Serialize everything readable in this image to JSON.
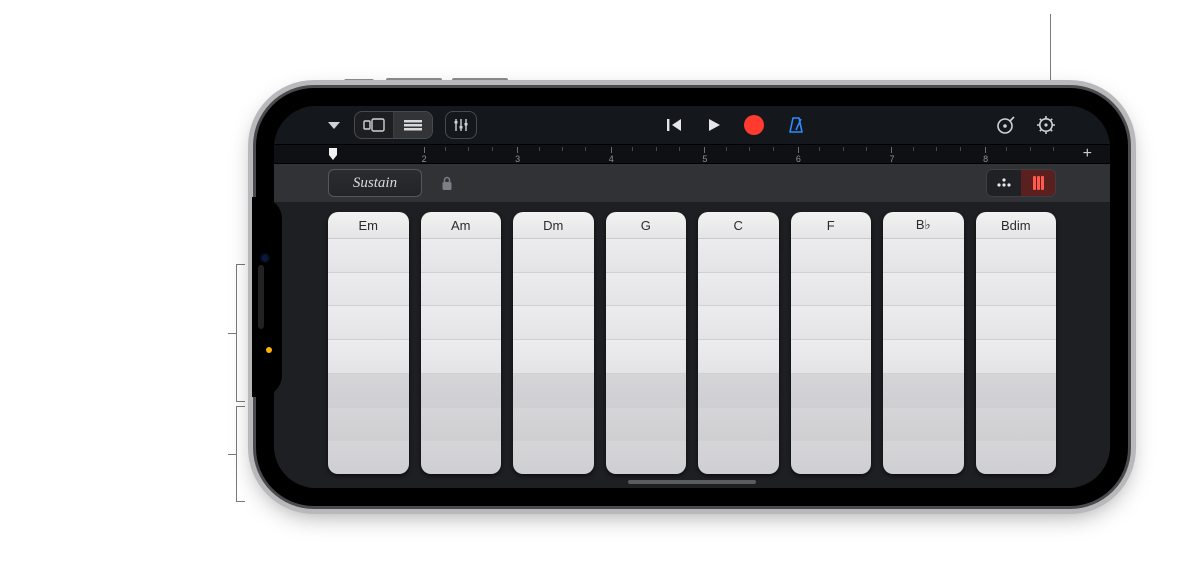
{
  "toolbar": {
    "rewind_icon": "rewind",
    "play_icon": "play",
    "record_icon": "record",
    "metronome_icon": "metronome",
    "instrument_icon": "instrument-browser",
    "settings_icon": "song-settings"
  },
  "ruler": {
    "bars": [
      "2",
      "3",
      "4",
      "5",
      "6",
      "7",
      "8"
    ]
  },
  "instrument_bar": {
    "sustain_label": "Sustain"
  },
  "chords": [
    "Em",
    "Am",
    "Dm",
    "G",
    "C",
    "F",
    "B♭",
    "Bdim"
  ],
  "chord_segments": {
    "light": 4,
    "dark": 3
  }
}
